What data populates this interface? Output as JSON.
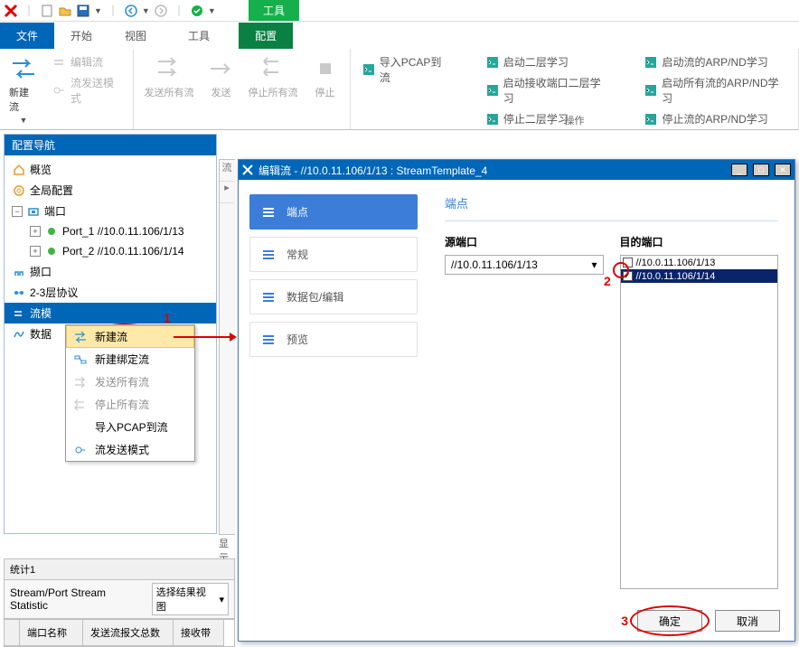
{
  "qat": {},
  "tool_tab": "工具",
  "tabs": {
    "file": "文件",
    "start": "开始",
    "view": "视图",
    "tools": "工具",
    "config": "配置"
  },
  "ribbon": {
    "new_flow": "新建流",
    "edit_flow": "编辑流",
    "flow_send_mode": "流发送模式",
    "send_all": "发送所有流",
    "send": "发送",
    "stop_all": "停止所有流",
    "stop": "停止",
    "import_pcap": "导入PCAP到流",
    "start_l2": "启动二层学习",
    "start_rx_l2": "启动接收端口二层学习",
    "stop_l2": "停止二层学习",
    "start_arp_flow": "启动流的ARP/ND学习",
    "start_arp_all": "启动所有流的ARP/ND学习",
    "stop_arp_flow": "停止流的ARP/ND学习",
    "group_title": "操作"
  },
  "nav": {
    "title": "配置导航",
    "overview": "概览",
    "global": "全局配置",
    "ports": "端口",
    "port1": "Port_1 //10.0.11.106/1/13",
    "port2": "Port_2 //10.0.11.106/1/14",
    "capture": "撷口",
    "l23": "2-3层协议",
    "flow_template": "流模",
    "data_item": "数据"
  },
  "context_menu": {
    "new_flow": "新建流",
    "new_bind": "新建绑定流",
    "send_all": "发送所有流",
    "stop_all": "停止所有流",
    "import_pcap": "导入PCAP到流",
    "flow_send_mode": "流发送模式"
  },
  "midbar": {
    "btn1": "流",
    "hidden_label": "显示结果"
  },
  "stats": {
    "title": "统计1",
    "tab": "Stream/Port Stream Statistic",
    "select_view": "选择结果视图",
    "col_port": "端口名称",
    "col_tx": "发送流报文总数",
    "col_rx": "接收带"
  },
  "dialog": {
    "title": "编辑流 - //10.0.11.106/1/13 : StreamTemplate_4",
    "side": {
      "endpoint": "端点",
      "general": "常规",
      "packet": "数据包/编辑",
      "preview": "预览"
    },
    "main_header": "端点",
    "src_port": "源端口",
    "dst_port": "目的端口",
    "src_value": "//10.0.11.106/1/13",
    "dst_item1": "//10.0.11.106/1/13",
    "dst_item2": "//10.0.11.106/1/14",
    "ok": "确定",
    "cancel": "取消"
  },
  "anno": {
    "n1": "1",
    "n2": "2",
    "n3": "3"
  }
}
